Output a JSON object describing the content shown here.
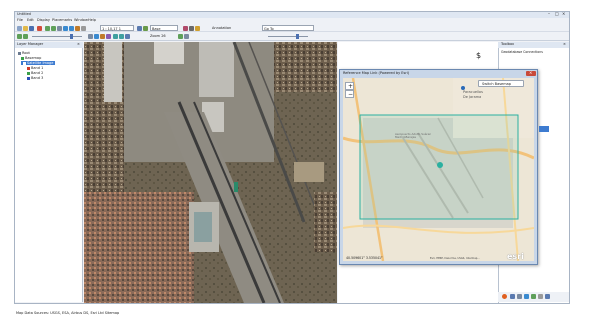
{
  "window": {
    "title": "Untitled"
  },
  "menu": [
    "File",
    "Edit",
    "Display",
    "Placemarks",
    "Window",
    "Help"
  ],
  "toolbar": {
    "scale_value": "1 : 10,17 1",
    "layer_dropdown": "Base",
    "annotation_label": "Annotation",
    "zoom_label": "Zoom 26",
    "extra_dropdown": "Go To"
  },
  "layer_manager": {
    "title": "Layer Manager",
    "items": [
      "Root",
      "Basemap",
      "Satellite Image",
      "Band 1",
      "Band 2",
      "Band 3"
    ],
    "band_colors": [
      "#d23a2a",
      "#3aa04a",
      "#2a4fb8"
    ]
  },
  "right_panel": {
    "title": "Toolbox",
    "subtitle": "Geodatabase Connections"
  },
  "popup": {
    "title": "Reference Map Link (Powered by Esri)",
    "switch_button": "Switch Basemap",
    "zoom_in": "+",
    "zoom_out": "−",
    "coords": "40.509601°  3.535041°",
    "attribution": "Esri, HERE, DeLorme, USGS, Intermap...",
    "esri": "esri",
    "place1_line1": "Paracuellos",
    "place1_line2": "De Jarama",
    "place2": "Aeropuerto Adolfo Suárez Madrid-Barajas",
    "close": "×"
  },
  "bottom_text": "Map Data Sources: USGS, ESA, Airbus DS, Esri Ltd Sitemap"
}
